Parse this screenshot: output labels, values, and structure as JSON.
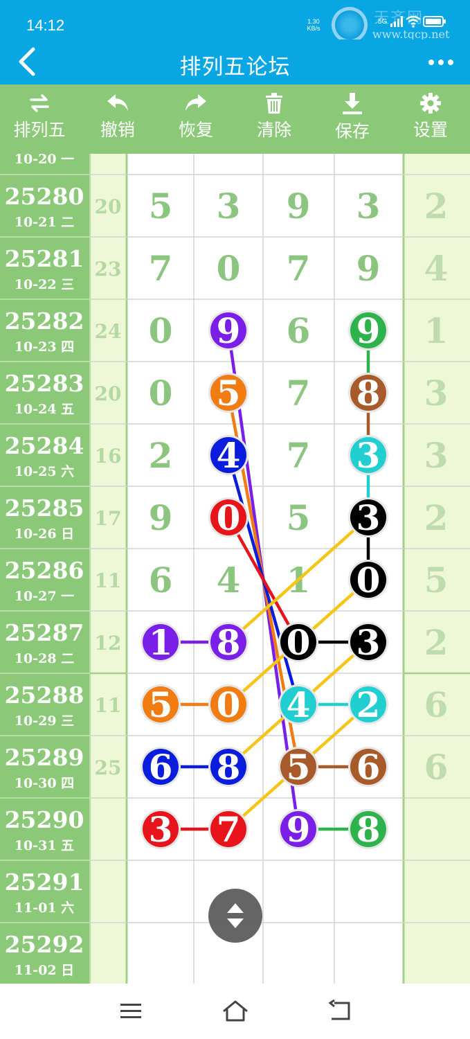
{
  "status_bar": {
    "time": "14:12",
    "net_speed": "1.30",
    "net_speed_unit": "KB/s",
    "network": "5G",
    "battery_icon": "battery-icon",
    "watermark_url": "www.tqcp.net",
    "watermark_name": "天齐网"
  },
  "app_bar": {
    "title": "排列五论坛",
    "back_icon": "back-arrow-icon",
    "more_icon": "more-dots-icon"
  },
  "toolbar": {
    "items": [
      {
        "label": "排列五",
        "icon": "swap-icon"
      },
      {
        "label": "撤销",
        "icon": "undo-icon"
      },
      {
        "label": "恢复",
        "icon": "redo-icon"
      },
      {
        "label": "清除",
        "icon": "trash-icon"
      },
      {
        "label": "保存",
        "icon": "download-icon"
      },
      {
        "label": "设置",
        "icon": "gear-icon"
      }
    ]
  },
  "colors": {
    "header_blue": "#08a7e4",
    "toolbar_green": "#8bc978",
    "issue_column_green": "#8bc978",
    "sum_column_bg": "#eef8d6",
    "last_column_bg": "#eef8d6",
    "digit_green": "#8cc57f"
  },
  "partial_top_row": {
    "date": "10-20 一"
  },
  "rows": [
    {
      "issue": "25280",
      "date": "10-21 二",
      "sum": "20",
      "digits": [
        "5",
        "3",
        "9",
        "3"
      ],
      "last": "2"
    },
    {
      "issue": "25281",
      "date": "10-22 三",
      "sum": "23",
      "digits": [
        "7",
        "0",
        "7",
        "9"
      ],
      "last": "4"
    },
    {
      "issue": "25282",
      "date": "10-23 四",
      "sum": "24",
      "digits": [
        "0",
        "9",
        "6",
        "9"
      ],
      "last": "1"
    },
    {
      "issue": "25283",
      "date": "10-24 五",
      "sum": "20",
      "digits": [
        "0",
        "5",
        "7",
        "8"
      ],
      "last": "3"
    },
    {
      "issue": "25284",
      "date": "10-25 六",
      "sum": "16",
      "digits": [
        "2",
        "4",
        "7",
        "3"
      ],
      "last": "3"
    },
    {
      "issue": "25285",
      "date": "10-26 日",
      "sum": "17",
      "digits": [
        "9",
        "0",
        "5",
        "3"
      ],
      "last": "2"
    },
    {
      "issue": "25286",
      "date": "10-27 一",
      "sum": "11",
      "digits": [
        "6",
        "4",
        "1",
        "0"
      ],
      "last": "5"
    },
    {
      "issue": "25287",
      "date": "10-28 二",
      "sum": "12",
      "digits": [
        "1",
        "8",
        "0",
        "3"
      ],
      "last": "2"
    },
    {
      "issue": "25288",
      "date": "10-29 三",
      "sum": "11",
      "digits": [
        "5",
        "0",
        "4",
        "2"
      ],
      "last": "6"
    },
    {
      "issue": "25289",
      "date": "10-30 四",
      "sum": "25",
      "digits": [
        "6",
        "8",
        "5",
        "6"
      ],
      "last": "6"
    },
    {
      "issue": "25290",
      "date": "10-31 五",
      "sum": "",
      "digits": [
        "3",
        "7",
        "9",
        "8"
      ],
      "last": ""
    },
    {
      "issue": "25291",
      "date": "11-01 六",
      "sum": "",
      "digits": [
        "",
        "",
        "",
        ""
      ],
      "last": ""
    },
    {
      "issue": "25292",
      "date": "11-02 日",
      "sum": "",
      "digits": [
        "",
        "",
        "",
        ""
      ],
      "last": ""
    }
  ],
  "marks": [
    {
      "row": 2,
      "col": 1,
      "value": "9",
      "color": "#7a1fe8"
    },
    {
      "row": 2,
      "col": 3,
      "value": "9",
      "color": "#2eb24b"
    },
    {
      "row": 3,
      "col": 1,
      "value": "5",
      "color": "#f07c12"
    },
    {
      "row": 3,
      "col": 3,
      "value": "8",
      "color": "#a85a2a"
    },
    {
      "row": 4,
      "col": 1,
      "value": "4",
      "color": "#0a1cdc"
    },
    {
      "row": 4,
      "col": 3,
      "value": "3",
      "color": "#21cfd0"
    },
    {
      "row": 5,
      "col": 1,
      "value": "0",
      "color": "#e8141c"
    },
    {
      "row": 5,
      "col": 3,
      "value": "3",
      "color": "#000000"
    },
    {
      "row": 6,
      "col": 3,
      "value": "0",
      "color": "#000000"
    },
    {
      "row": 7,
      "col": 0,
      "value": "1",
      "color": "#7a1fe8"
    },
    {
      "row": 7,
      "col": 1,
      "value": "8",
      "color": "#7a1fe8"
    },
    {
      "row": 7,
      "col": 2,
      "value": "0",
      "color": "#000000"
    },
    {
      "row": 7,
      "col": 3,
      "value": "3",
      "color": "#000000"
    },
    {
      "row": 8,
      "col": 0,
      "value": "5",
      "color": "#f07c12"
    },
    {
      "row": 8,
      "col": 1,
      "value": "0",
      "color": "#f07c12"
    },
    {
      "row": 8,
      "col": 2,
      "value": "4",
      "color": "#21cfd0"
    },
    {
      "row": 8,
      "col": 3,
      "value": "2",
      "color": "#21cfd0"
    },
    {
      "row": 9,
      "col": 0,
      "value": "6",
      "color": "#0a1cdc"
    },
    {
      "row": 9,
      "col": 1,
      "value": "8",
      "color": "#0a1cdc"
    },
    {
      "row": 9,
      "col": 2,
      "value": "5",
      "color": "#a85a2a"
    },
    {
      "row": 9,
      "col": 3,
      "value": "6",
      "color": "#a85a2a"
    },
    {
      "row": 10,
      "col": 0,
      "value": "3",
      "color": "#e8141c"
    },
    {
      "row": 10,
      "col": 1,
      "value": "7",
      "color": "#e8141c"
    },
    {
      "row": 10,
      "col": 2,
      "value": "9",
      "color": "#7a1fe8"
    },
    {
      "row": 10,
      "col": 3,
      "value": "8",
      "color": "#2eb24b"
    }
  ],
  "connectors": [
    {
      "color": "#2eb24b",
      "from": [
        2,
        3
      ],
      "to": [
        3,
        3
      ]
    },
    {
      "color": "#a85a2a",
      "from": [
        3,
        3
      ],
      "to": [
        4,
        3
      ]
    },
    {
      "color": "#21cfd0",
      "from": [
        4,
        3
      ],
      "to": [
        5,
        3
      ]
    },
    {
      "color": "#000000",
      "from": [
        5,
        3
      ],
      "to": [
        6,
        3
      ]
    },
    {
      "color": "#7a1fe8",
      "from": [
        2,
        1
      ],
      "to": [
        10,
        2
      ]
    },
    {
      "color": "#f07c12",
      "from": [
        3,
        1
      ],
      "to": [
        9,
        2
      ]
    },
    {
      "color": "#0a1cdc",
      "from": [
        4,
        1
      ],
      "to": [
        8,
        2
      ]
    },
    {
      "color": "#e8141c",
      "from": [
        5,
        1
      ],
      "to": [
        7,
        2
      ]
    },
    {
      "color": "#f5c518",
      "from": [
        5,
        3
      ],
      "to": [
        7,
        1
      ]
    },
    {
      "color": "#f5c518",
      "from": [
        6,
        3
      ],
      "to": [
        8,
        1
      ]
    },
    {
      "color": "#f5c518",
      "from": [
        7,
        3
      ],
      "to": [
        9,
        1
      ]
    },
    {
      "color": "#f5c518",
      "from": [
        8,
        3
      ],
      "to": [
        10,
        1
      ]
    },
    {
      "color": "#7a1fe8",
      "from": [
        7,
        0
      ],
      "to": [
        7,
        1
      ]
    },
    {
      "color": "#000000",
      "from": [
        7,
        2
      ],
      "to": [
        7,
        3
      ]
    },
    {
      "color": "#f07c12",
      "from": [
        8,
        0
      ],
      "to": [
        8,
        1
      ]
    },
    {
      "color": "#21cfd0",
      "from": [
        8,
        2
      ],
      "to": [
        8,
        3
      ]
    },
    {
      "color": "#0a1cdc",
      "from": [
        9,
        0
      ],
      "to": [
        9,
        1
      ]
    },
    {
      "color": "#a85a2a",
      "from": [
        9,
        2
      ],
      "to": [
        9,
        3
      ]
    },
    {
      "color": "#e8141c",
      "from": [
        10,
        0
      ],
      "to": [
        10,
        1
      ]
    },
    {
      "color": "#2eb24b",
      "from": [
        10,
        2
      ],
      "to": [
        10,
        3
      ]
    }
  ],
  "scroll_button": {
    "icon": "scroll-up-down-icon"
  },
  "nav_bar": {
    "menu_icon": "menu-icon",
    "home_icon": "home-icon",
    "back_icon": "back-return-icon"
  }
}
